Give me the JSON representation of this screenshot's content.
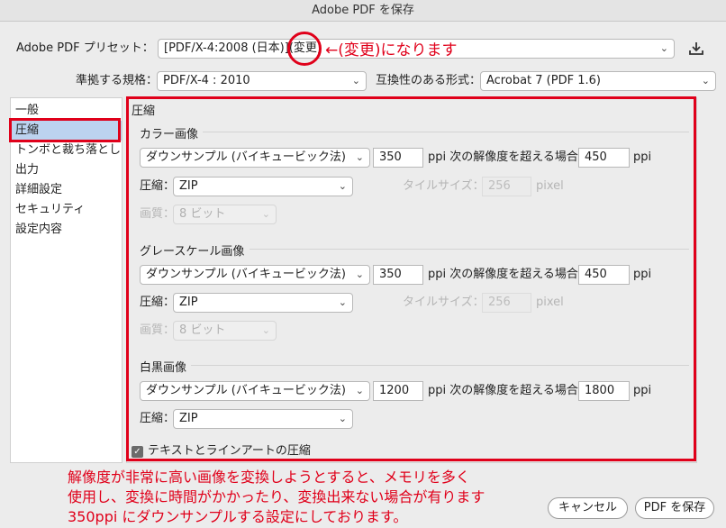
{
  "window": {
    "title": "Adobe PDF を保存"
  },
  "preset": {
    "label": "Adobe PDF プリセット：",
    "value": "[PDF/X-4:2008 (日本)]",
    "changed": "(変更)"
  },
  "annotation": {
    "arrow_text": "←(変更)になります"
  },
  "standard": {
    "label": "準拠する規格：",
    "value": "PDF/X-4 : 2010"
  },
  "compat": {
    "label": "互換性のある形式：",
    "value": "Acrobat 7 (PDF 1.6)"
  },
  "sidebar": {
    "items": [
      {
        "label": "一般"
      },
      {
        "label": "圧縮"
      },
      {
        "label": "トンボと裁ち落とし"
      },
      {
        "label": "出力"
      },
      {
        "label": "詳細設定"
      },
      {
        "label": "セキュリティ"
      },
      {
        "label": "設定内容"
      }
    ]
  },
  "panel": {
    "title": "圧縮",
    "color": {
      "title": "カラー画像",
      "downsample": "ダウンサンプル (バイキュービック法)",
      "ppi_value": "350",
      "ppi_text": "ppi 次の解像度を超える場合",
      "above_value": "450",
      "above_unit": "ppi",
      "compression_label": "圧縮：",
      "compression_value": "ZIP",
      "tile_label": "タイルサイズ：",
      "tile_value": "256",
      "tile_unit": "pixel",
      "quality_label": "画質：",
      "quality_value": "8 ビット"
    },
    "gray": {
      "title": "グレースケール画像",
      "downsample": "ダウンサンプル (バイキュービック法)",
      "ppi_value": "350",
      "ppi_text": "ppi 次の解像度を超える場合",
      "above_value": "450",
      "above_unit": "ppi",
      "compression_label": "圧縮：",
      "compression_value": "ZIP",
      "tile_label": "タイルサイズ：",
      "tile_value": "256",
      "tile_unit": "pixel",
      "quality_label": "画質：",
      "quality_value": "8 ビット"
    },
    "mono": {
      "title": "白黒画像",
      "downsample": "ダウンサンプル (バイキュービック法)",
      "ppi_value": "1200",
      "ppi_text": "ppi 次の解像度を超える場合",
      "above_value": "1800",
      "above_unit": "ppi",
      "compression_label": "圧縮：",
      "compression_value": "ZIP"
    },
    "compress_text_label": "テキストとラインアートの圧縮"
  },
  "note": {
    "line1": "解像度が非常に高い画像を変換しようとすると、メモリを多く",
    "line2": "使用し、変換に時間がかかったり、変換出来ない場合が有ります",
    "line3": "350ppi にダウンサンプルする設定にしております。"
  },
  "buttons": {
    "cancel": "キャンセル",
    "save": "PDF を保存"
  },
  "colors": {
    "annotation_red": "#e0001a",
    "selection": "#bcd3ef"
  }
}
